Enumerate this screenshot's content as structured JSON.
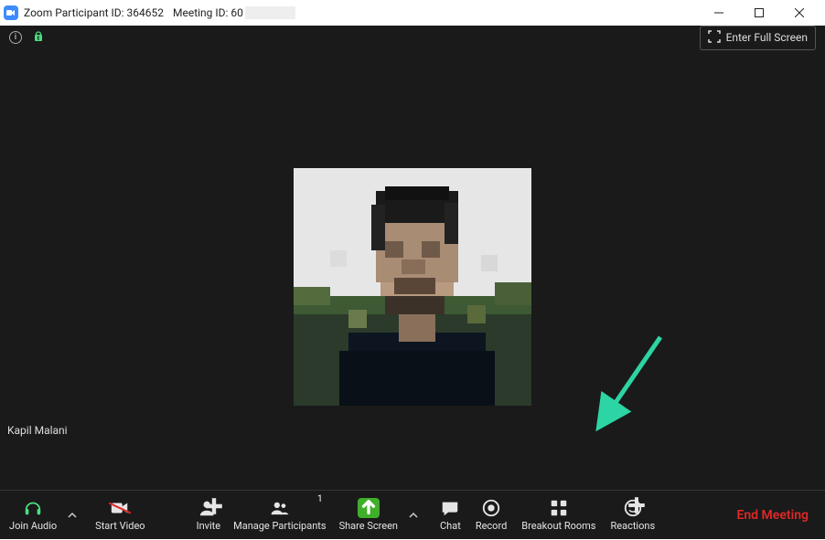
{
  "titlebar": {
    "participant_id_label": "Zoom Participant ID: 364652",
    "meeting_id_label": "Meeting ID: 60"
  },
  "top": {
    "fullscreen_label": "Enter Full Screen"
  },
  "participant_name": "Kapil Malani",
  "toolbar": {
    "join_audio": "Join Audio",
    "start_video": "Start Video",
    "invite": "Invite",
    "manage_participants": "Manage Participants",
    "participants_count": "1",
    "share_screen": "Share Screen",
    "chat": "Chat",
    "record": "Record",
    "breakout_rooms": "Breakout Rooms",
    "reactions": "Reactions",
    "end_meeting": "End Meeting"
  },
  "colors": {
    "green": "#4ade80",
    "share_green": "#3fae29",
    "end_red": "#e02828",
    "arrow": "#2dd4a4"
  }
}
